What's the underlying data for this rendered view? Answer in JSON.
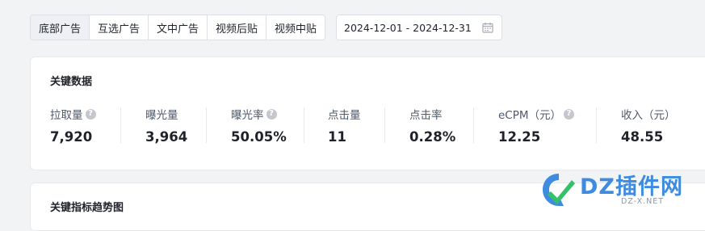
{
  "tabs": [
    "底部广告",
    "互选广告",
    "文中广告",
    "视频后贴",
    "视频中贴"
  ],
  "active_tab": "底部广告",
  "date_range": {
    "start": "2024-12-01",
    "separator": "-",
    "end": "2024-12-31",
    "icon": "calendar-icon"
  },
  "key_data": {
    "title": "关键数据",
    "metrics": [
      {
        "label": "拉取量",
        "value": "7,920",
        "help": true
      },
      {
        "label": "曝光量",
        "value": "3,964",
        "help": false
      },
      {
        "label": "曝光率",
        "value": "50.05%",
        "help": true
      },
      {
        "label": "点击量",
        "value": "11",
        "help": false
      },
      {
        "label": "点击率",
        "value": "0.28%",
        "help": false
      },
      {
        "label": "eCPM（元）",
        "value": "12.25",
        "help": true
      },
      {
        "label": "收入（元）",
        "value": "48.55",
        "help": false
      }
    ]
  },
  "trend": {
    "title": "关键指标趋势图"
  },
  "watermark": {
    "brand": "DZ插件网",
    "domain": "DZ-X.NET"
  },
  "colors": {
    "accent_blue": "#3e8be0",
    "accent_green": "#35c06a",
    "page_bg": "#f2f3f5"
  }
}
